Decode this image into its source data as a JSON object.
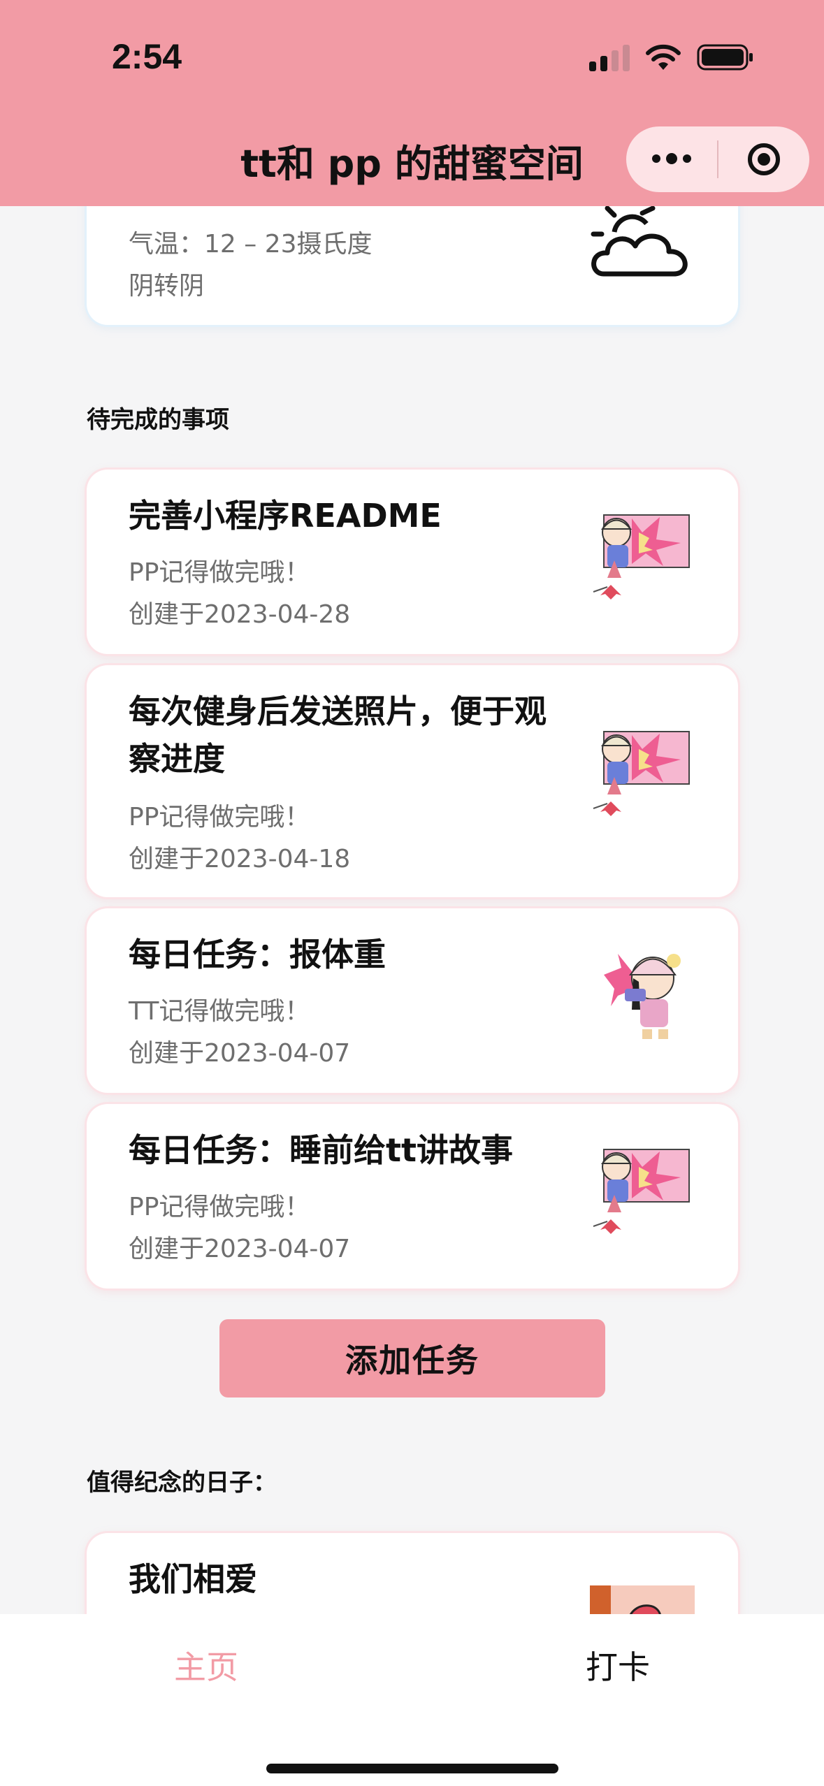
{
  "status_bar": {
    "time": "2:54"
  },
  "nav": {
    "title": "tt和 pp 的甜蜜空间"
  },
  "weather": {
    "temperature": "气温：12 – 23摄氏度",
    "condition": "阴转阴",
    "icon": "cloud-sun-icon"
  },
  "todo_section": {
    "label": "待完成的事项"
  },
  "tasks": [
    {
      "title": "完善小程序README",
      "reminder": "PP记得做完哦！",
      "created": "创建于2023-04-28"
    },
    {
      "title": "每次健身后发送照片，便于观察进度",
      "reminder": "PP记得做完哦！",
      "created": "创建于2023-04-18"
    },
    {
      "title": "每日任务：报体重",
      "reminder": "TT记得做完哦！",
      "created": "创建于2023-04-07"
    },
    {
      "title": "每日任务：睡前给tt讲故事",
      "reminder": "PP记得做完哦！",
      "created": "创建于2023-04-07"
    }
  ],
  "add_task_label": "添加任务",
  "anniversary_section": {
    "label": "值得纪念的日子："
  },
  "anniversaries": [
    {
      "title": "我们相爱"
    }
  ],
  "tabbar": {
    "home": "主页",
    "checkin": "打卡"
  },
  "colors": {
    "accent": "#f29ba5",
    "tab_active": "#f29ba5"
  }
}
